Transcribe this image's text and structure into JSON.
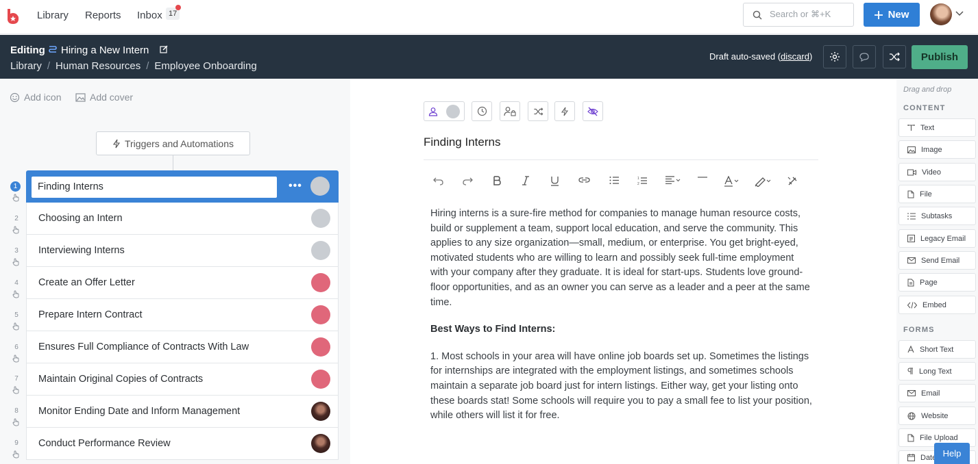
{
  "nav": {
    "library": "Library",
    "reports": "Reports",
    "inbox": "Inbox",
    "inbox_count": "17",
    "search_placeholder": "Search or ⌘+K",
    "new_label": "New"
  },
  "editbar": {
    "editing": "Editing",
    "title": "Hiring a New Intern",
    "breadcrumb": [
      "Library",
      "Human Resources",
      "Employee Onboarding"
    ],
    "draft_text": "Draft auto-saved (",
    "discard": "discard",
    "draft_close": ")",
    "publish": "Publish"
  },
  "left": {
    "add_icon": "Add icon",
    "add_cover": "Add cover",
    "triggers": "Triggers and Automations",
    "tasks": [
      {
        "num": "1",
        "label": "Finding Interns",
        "assignee": "grey"
      },
      {
        "num": "2",
        "label": "Choosing an Intern",
        "assignee": "grey"
      },
      {
        "num": "3",
        "label": "Interviewing Interns",
        "assignee": "grey"
      },
      {
        "num": "4",
        "label": "Create an Offer Letter",
        "assignee": "red"
      },
      {
        "num": "5",
        "label": "Prepare Intern Contract",
        "assignee": "red"
      },
      {
        "num": "6",
        "label": "Ensures Full Compliance of Contracts With Law",
        "assignee": "red"
      },
      {
        "num": "7",
        "label": "Maintain Original Copies of Contracts",
        "assignee": "red"
      },
      {
        "num": "8",
        "label": "Monitor Ending Date and Inform Management",
        "assignee": "dark"
      },
      {
        "num": "9",
        "label": "Conduct Performance Review",
        "assignee": "dark"
      }
    ]
  },
  "center": {
    "step_title": "Finding Interns",
    "para1": "Hiring interns is a sure-fire method for companies to manage human resource costs, build or supplement a team, support local education, and serve the community. This applies to any size organization—small, medium, or enterprise. You get bright-eyed, motivated students who are willing to learn and possibly seek full-time employment with your company after they graduate. It is ideal for start-ups. Students love ground-floor opportunities, and as an owner you can serve as a leader and a peer at the same time.",
    "heading": "Best Ways to Find Interns:",
    "para2": "1. Most schools in your area will have online job boards set up. Sometimes the listings for internships are integrated with the employment listings, and sometimes schools maintain a separate job board just for intern listings. Either way, get your listing onto these boards stat! Some schools will require you to pay a small fee to list your position, while others will list it for free."
  },
  "right": {
    "drag_drop": "Drag and drop",
    "content_header": "CONTENT",
    "content": [
      "Text",
      "Image",
      "Video",
      "File",
      "Subtasks",
      "Legacy Email",
      "Send Email",
      "Page",
      "Embed"
    ],
    "forms_header": "FORMS",
    "forms": [
      "Short Text",
      "Long Text",
      "Email",
      "Website",
      "File Upload",
      "Date"
    ],
    "help": "Help"
  },
  "colors": {
    "brand_blue": "#2f7fd6",
    "header_dark": "#263340",
    "publish_green": "#4fae89",
    "assignee_red": "#e0677a"
  }
}
